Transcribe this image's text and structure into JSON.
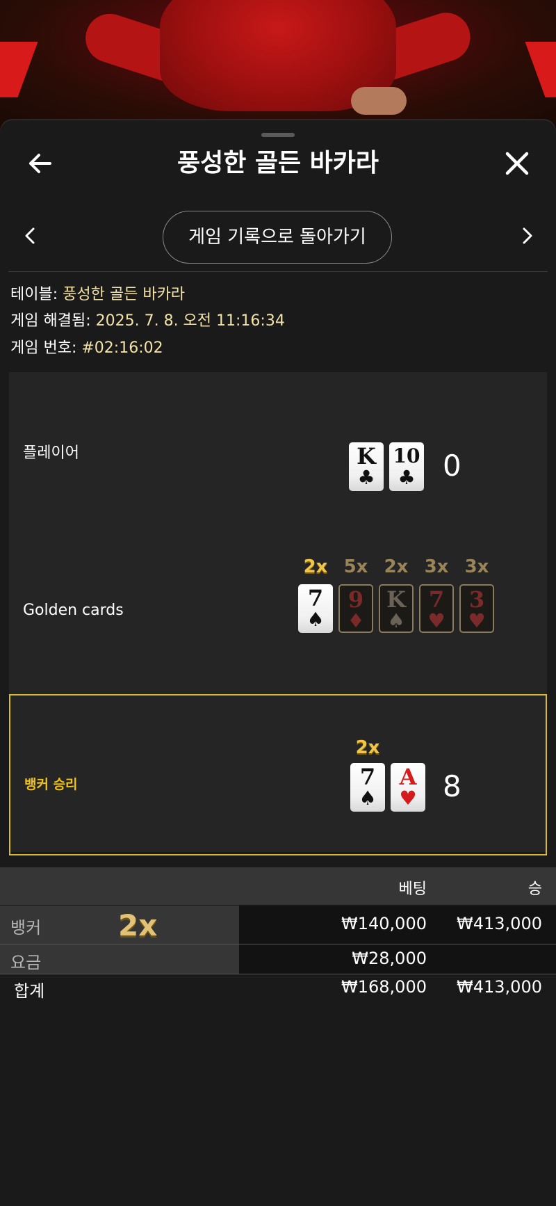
{
  "header": {
    "title": "풍성한 골든 바카라",
    "back_icon": "arrow-left-icon",
    "close_icon": "close-icon"
  },
  "nav": {
    "history_button": "게임 기록으로 돌아가기",
    "prev_icon": "chevron-left-icon",
    "next_icon": "chevron-right-icon"
  },
  "info": {
    "table_label": "테이블:",
    "table_value": "풍성한 골든 바카라",
    "resolved_label": "게임 해결됨:",
    "resolved_value": "2025. 7. 8. 오전 11:16:34",
    "number_label": "게임 번호:",
    "number_value": "#02:16:02"
  },
  "result": {
    "player": {
      "label": "플레이어",
      "score": "0",
      "cards": [
        {
          "rank": "K",
          "suit": "♣",
          "color": "black"
        },
        {
          "rank": "10",
          "suit": "♣",
          "color": "black"
        }
      ]
    },
    "golden": {
      "label": "Golden cards",
      "cards": [
        {
          "mult": "2x",
          "rank": "7",
          "suit": "♠",
          "color": "black",
          "active": true
        },
        {
          "mult": "5x",
          "rank": "9",
          "suit": "♦",
          "color": "red",
          "active": false
        },
        {
          "mult": "2x",
          "rank": "K",
          "suit": "♠",
          "color": "black",
          "active": false
        },
        {
          "mult": "3x",
          "rank": "7",
          "suit": "♥",
          "color": "red",
          "active": false
        },
        {
          "mult": "3x",
          "rank": "3",
          "suit": "♥",
          "color": "red",
          "active": false
        }
      ]
    },
    "banker": {
      "label": "뱅커 승리",
      "score": "8",
      "mult": "2x",
      "cards": [
        {
          "rank": "7",
          "suit": "♠",
          "color": "black"
        },
        {
          "rank": "A",
          "suit": "♥",
          "color": "red"
        }
      ]
    }
  },
  "bets": {
    "headers": {
      "bet": "베팅",
      "win": "승"
    },
    "rows": [
      {
        "name": "뱅커",
        "mult": "2x",
        "bet": "₩140,000",
        "win": "₩413,000"
      },
      {
        "name": "요금",
        "bet": "₩28,000",
        "win": ""
      }
    ],
    "total": {
      "name": "합계",
      "bet": "₩168,000",
      "win": "₩413,000"
    }
  },
  "colors": {
    "accent_gold": "#f2c31a",
    "info_value": "#f3e3a8",
    "banker_border": "#d9b92c",
    "background": "#1a1a1a"
  }
}
